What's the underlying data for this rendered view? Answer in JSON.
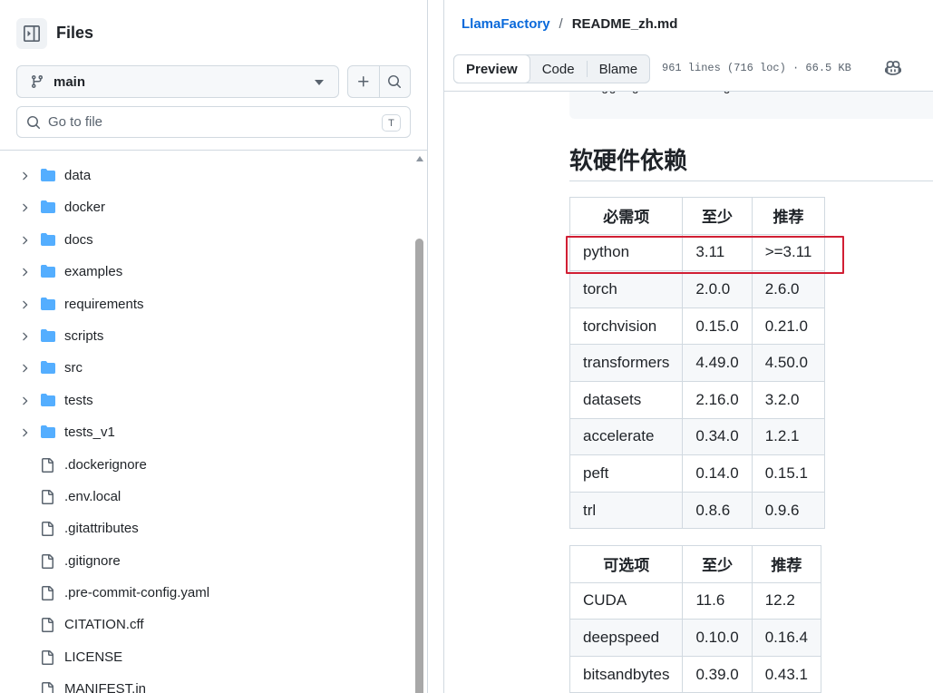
{
  "sidebar": {
    "title": "Files",
    "branch": "main",
    "search_placeholder": "Go to file",
    "search_shortcut": "T",
    "items": [
      {
        "name": "data",
        "type": "folder"
      },
      {
        "name": "docker",
        "type": "folder"
      },
      {
        "name": "docs",
        "type": "folder"
      },
      {
        "name": "examples",
        "type": "folder"
      },
      {
        "name": "requirements",
        "type": "folder"
      },
      {
        "name": "scripts",
        "type": "folder"
      },
      {
        "name": "src",
        "type": "folder"
      },
      {
        "name": "tests",
        "type": "folder"
      },
      {
        "name": "tests_v1",
        "type": "folder"
      },
      {
        "name": ".dockerignore",
        "type": "file"
      },
      {
        "name": ".env.local",
        "type": "file"
      },
      {
        "name": ".gitattributes",
        "type": "file"
      },
      {
        "name": ".gitignore",
        "type": "file"
      },
      {
        "name": ".pre-commit-config.yaml",
        "type": "file"
      },
      {
        "name": "CITATION.cff",
        "type": "file"
      },
      {
        "name": "LICENSE",
        "type": "file"
      },
      {
        "name": "MANIFEST.in",
        "type": "file"
      }
    ]
  },
  "header": {
    "repo": "LlamaFactory",
    "separator": "/",
    "file": "README_zh.md",
    "tabs": [
      "Preview",
      "Code",
      "Blame"
    ],
    "active_tab": "Preview",
    "file_info": "961 lines (716 loc) · 66.5 KB"
  },
  "content": {
    "code_snippet": "huggingface-cli login",
    "heading": "软硬件依赖",
    "required_table": {
      "headers": [
        "必需项",
        "至少",
        "推荐"
      ],
      "rows": [
        [
          "python",
          "3.11",
          ">=3.11"
        ],
        [
          "torch",
          "2.0.0",
          "2.6.0"
        ],
        [
          "torchvision",
          "0.15.0",
          "0.21.0"
        ],
        [
          "transformers",
          "4.49.0",
          "4.50.0"
        ],
        [
          "datasets",
          "2.16.0",
          "3.2.0"
        ],
        [
          "accelerate",
          "0.34.0",
          "1.2.1"
        ],
        [
          "peft",
          "0.14.0",
          "0.15.1"
        ],
        [
          "trl",
          "0.8.6",
          "0.9.6"
        ]
      ]
    },
    "optional_table": {
      "headers": [
        "可选项",
        "至少",
        "推荐"
      ],
      "rows": [
        [
          "CUDA",
          "11.6",
          "12.2"
        ],
        [
          "deepspeed",
          "0.10.0",
          "0.16.4"
        ],
        [
          "bitsandbytes",
          "0.39.0",
          "0.43.1"
        ]
      ]
    }
  },
  "colors": {
    "link": "#0969da",
    "folder": "#54aeff",
    "highlight": "#d11f34",
    "border": "#d1d9e0"
  }
}
